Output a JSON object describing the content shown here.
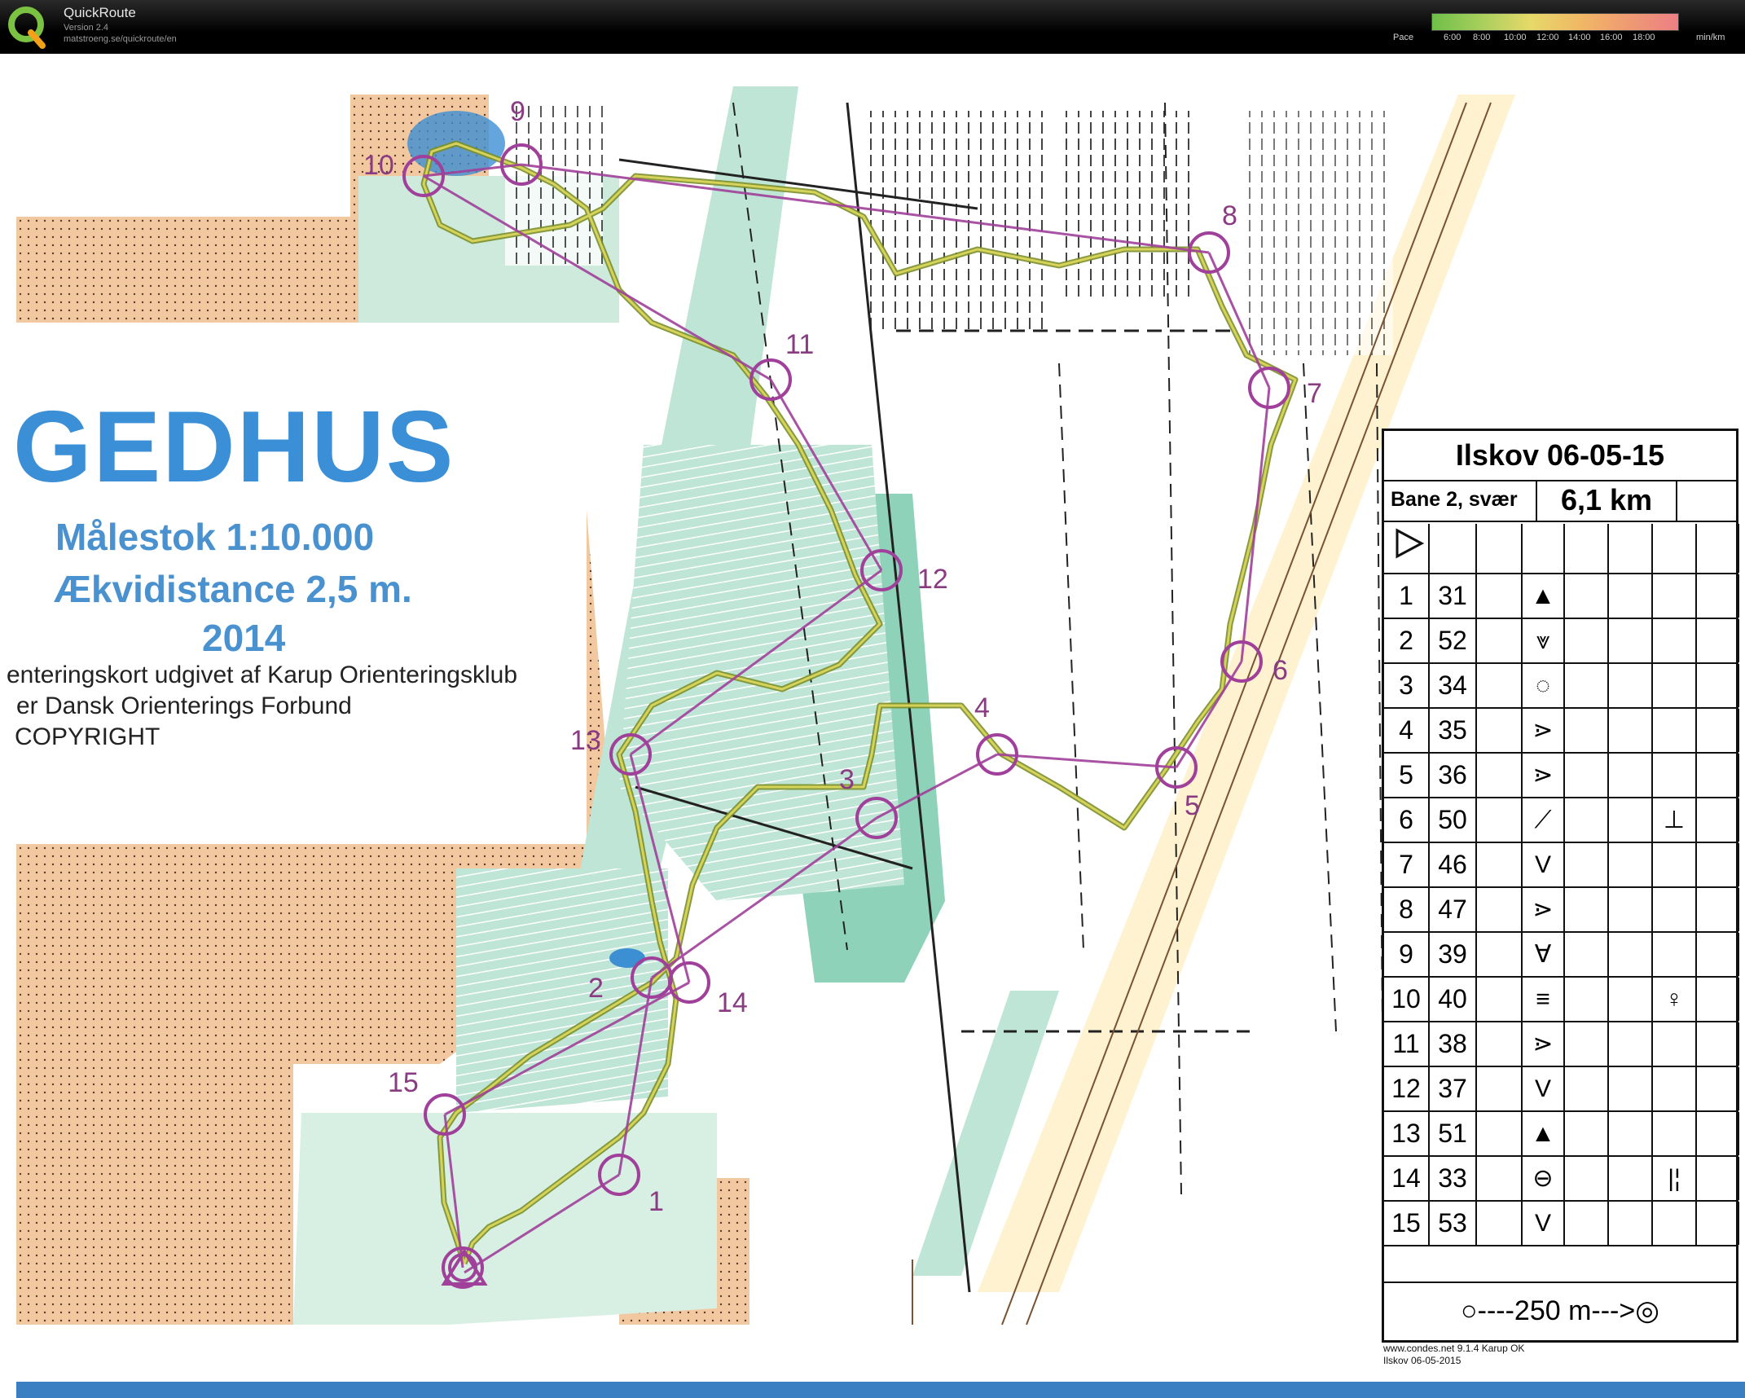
{
  "app": {
    "name": "QuickRoute",
    "version": "Version 2.4",
    "url": "matstroeng.se/quickroute/en",
    "logo_letter": "Q"
  },
  "pace_legend": {
    "label": "Pace",
    "ticks": [
      "6:00",
      "8:00",
      "10:00",
      "12:00",
      "14:00",
      "16:00",
      "18:00"
    ],
    "unit": "min/km",
    "colors": [
      "#6fbf4a",
      "#a8cf5c",
      "#e6d969",
      "#f0b865",
      "#ef9a73",
      "#ec7f84"
    ]
  },
  "map": {
    "name": "GEDHUS",
    "scale": "Målestok 1:10.000",
    "equidistance": "Ækvidistance 2,5 m.",
    "year": "2014",
    "publisher": "enteringskort udgivet af Karup Orienteringsklub",
    "federation": "er Dansk Orienterings Forbund",
    "copyright": "COPYRIGHT"
  },
  "controls": [
    "1",
    "2",
    "3",
    "4",
    "5",
    "6",
    "7",
    "8",
    "9",
    "10",
    "11",
    "12",
    "13",
    "14",
    "15"
  ],
  "description_sheet": {
    "event": "Ilskov 06-05-15",
    "course": "Bane 2, svær",
    "length": "6,1 km",
    "rows": [
      {
        "num": "1",
        "code": "31",
        "symbol": "▲",
        "extra": ""
      },
      {
        "num": "2",
        "code": "52",
        "symbol": "⩔",
        "extra": ""
      },
      {
        "num": "3",
        "code": "34",
        "symbol": "◌",
        "extra": ""
      },
      {
        "num": "4",
        "code": "35",
        "symbol": "⋗",
        "extra": ""
      },
      {
        "num": "5",
        "code": "36",
        "symbol": "⋗",
        "extra": ""
      },
      {
        "num": "6",
        "code": "50",
        "symbol": "⟋",
        "extra": "⊥"
      },
      {
        "num": "7",
        "code": "46",
        "symbol": "V",
        "extra": ""
      },
      {
        "num": "8",
        "code": "47",
        "symbol": "⋗",
        "extra": ""
      },
      {
        "num": "9",
        "code": "39",
        "symbol": "Ɐ",
        "extra": ""
      },
      {
        "num": "10",
        "code": "40",
        "symbol": "≡",
        "extra": "♀"
      },
      {
        "num": "11",
        "code": "38",
        "symbol": "⋗",
        "extra": ""
      },
      {
        "num": "12",
        "code": "37",
        "symbol": "V",
        "extra": ""
      },
      {
        "num": "13",
        "code": "51",
        "symbol": "▲",
        "extra": ""
      },
      {
        "num": "14",
        "code": "33",
        "symbol": "⊖",
        "extra": "|¦"
      },
      {
        "num": "15",
        "code": "53",
        "symbol": "V",
        "extra": ""
      }
    ],
    "finish": "○----250 m--->◎"
  },
  "footer": {
    "url": "www.condes.net 9.1.4 Karup OK",
    "event": "Ilskov 06-05-2015"
  }
}
